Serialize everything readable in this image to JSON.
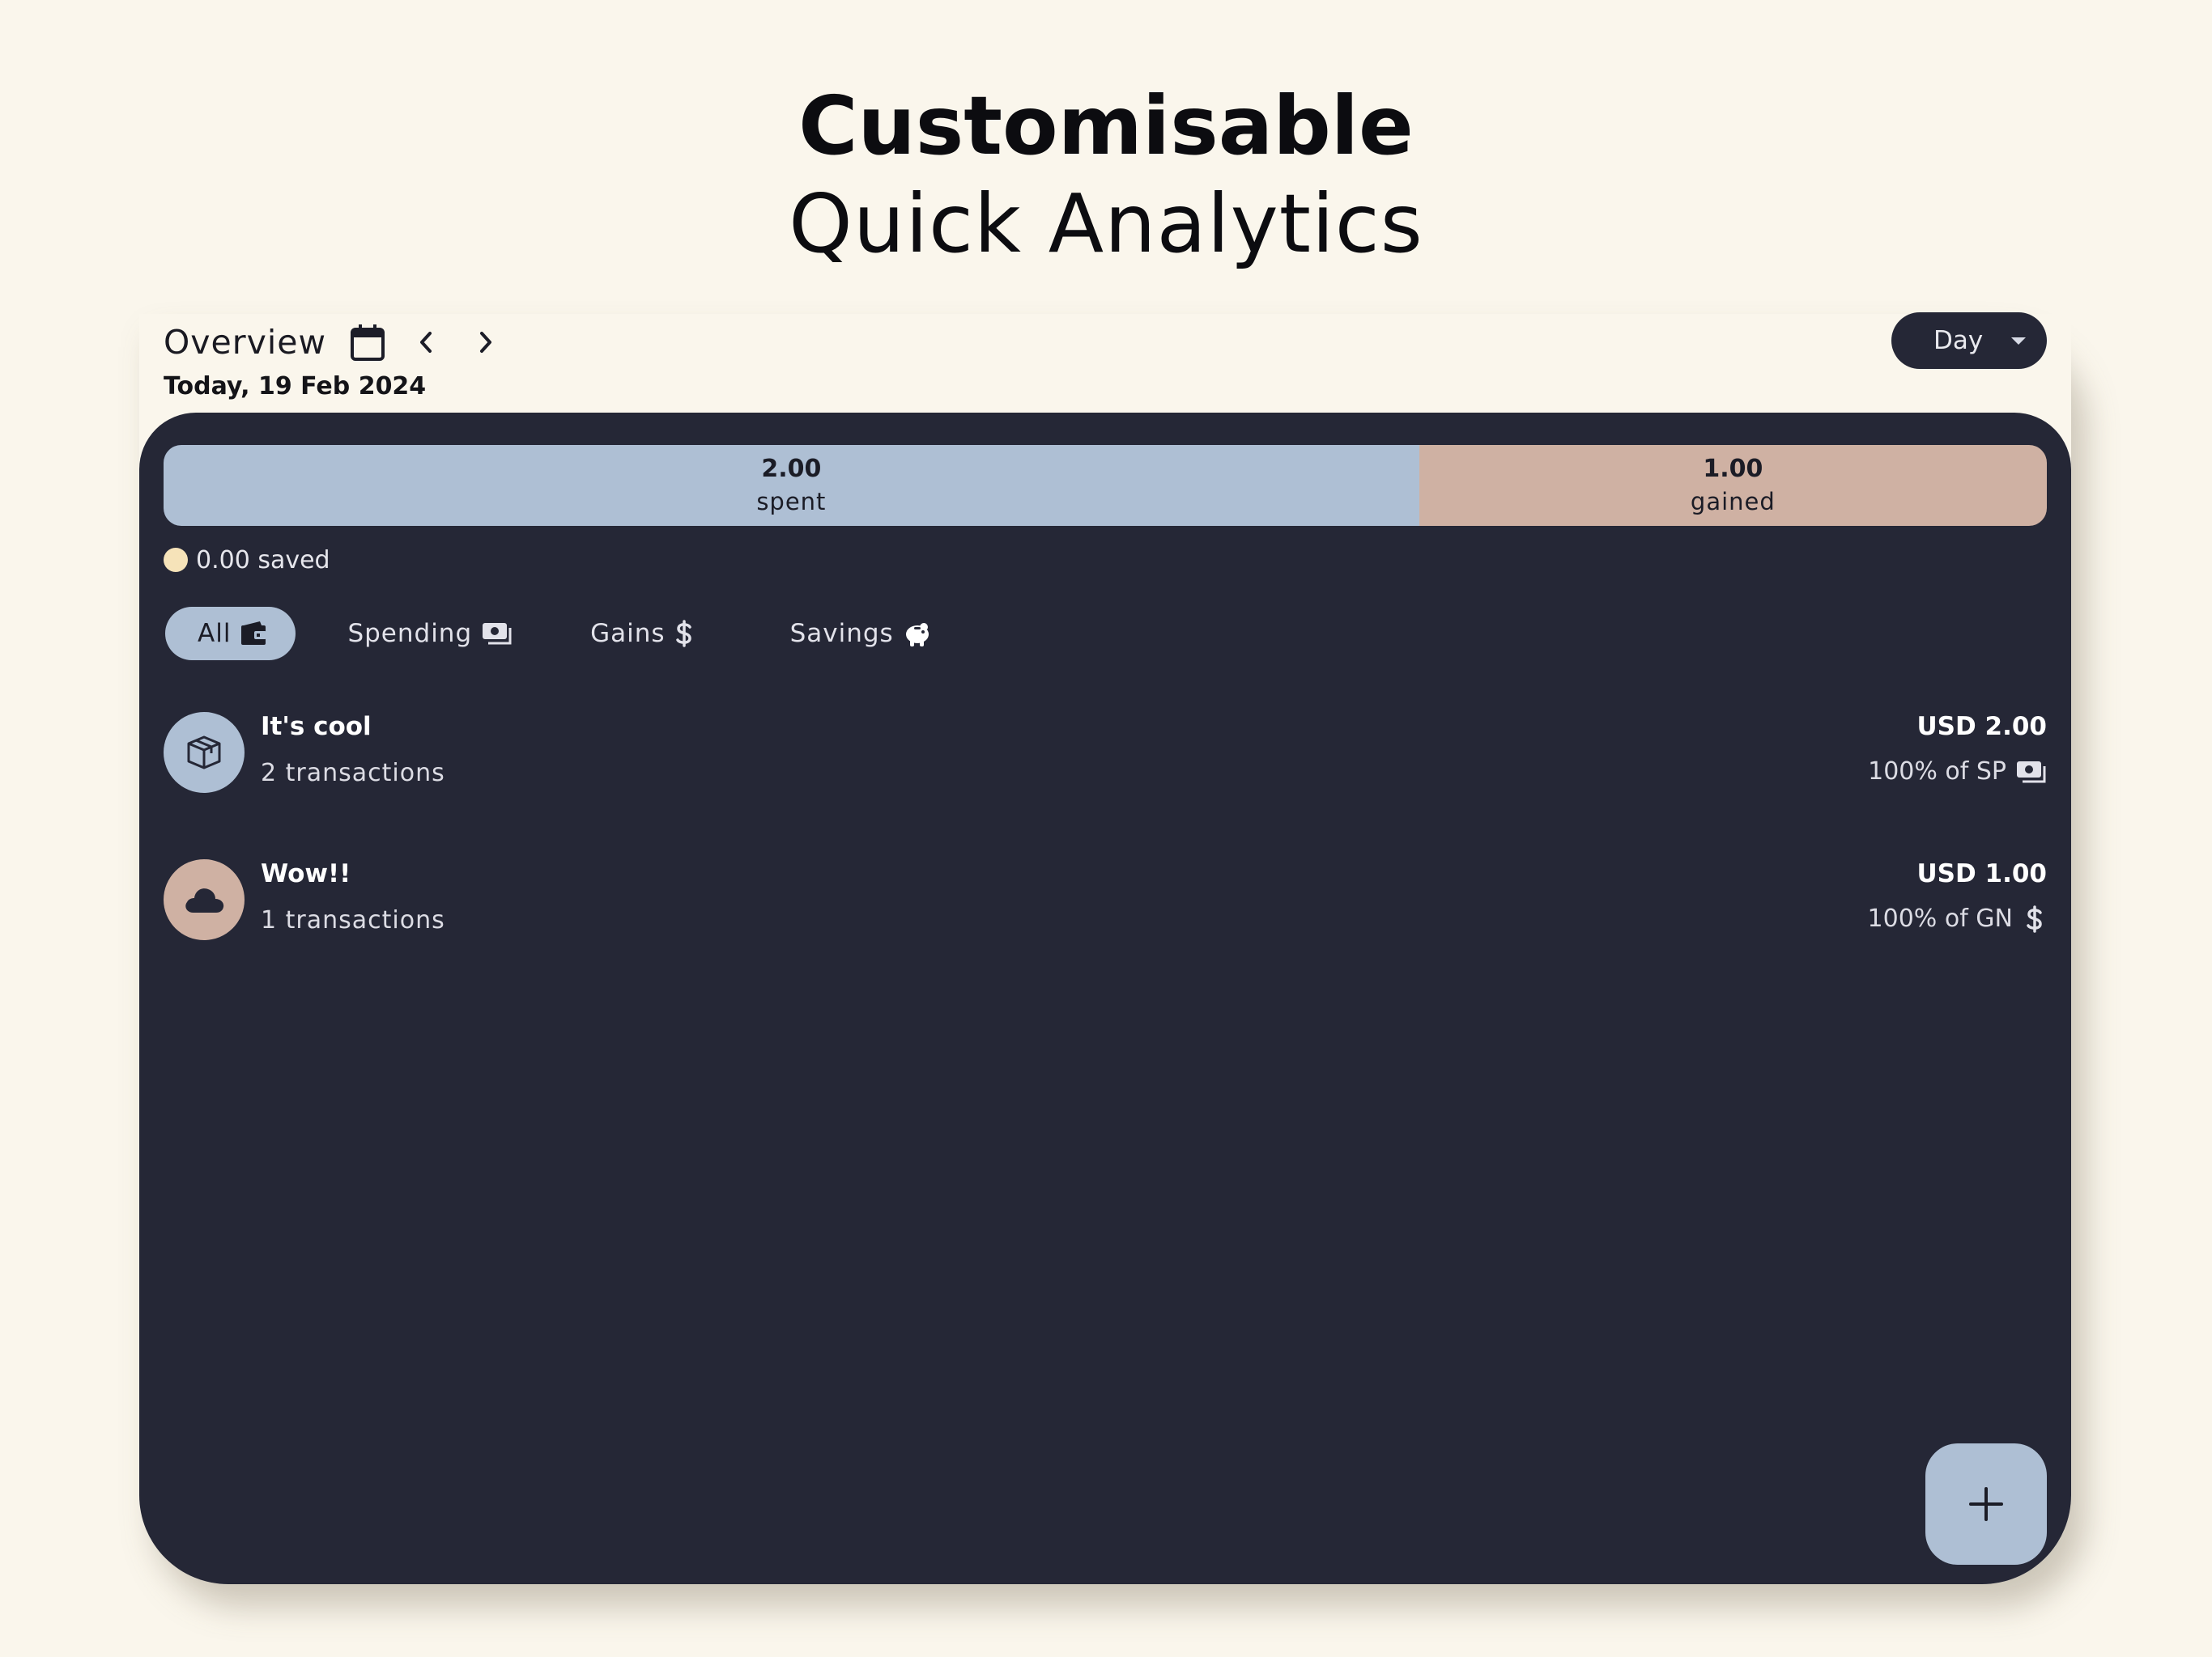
{
  "headline": {
    "title_bold": "Customisable",
    "title_light": "Quick Analytics"
  },
  "header": {
    "title": "Overview",
    "date": "Today, 19 Feb 2024",
    "period": "Day",
    "icons": [
      "calendar-icon",
      "chevron-left-icon",
      "chevron-right-icon",
      "caret-down-icon"
    ]
  },
  "summary": {
    "spent_value": "2.00",
    "spent_label": "spent",
    "gained_value": "1.00",
    "gained_label": "gained",
    "spent_fraction": 0.6667,
    "saved_text": "0.00 saved",
    "colors": {
      "spent": "#aebfd4",
      "gained": "#cfb1a3",
      "saved": "#f6e3b9"
    }
  },
  "tabs": [
    {
      "label": "All",
      "icon": "wallet-icon",
      "active": true
    },
    {
      "label": "Spending",
      "icon": "money-icon",
      "active": false
    },
    {
      "label": "Gains",
      "icon": "dollar-icon",
      "active": false
    },
    {
      "label": "Savings",
      "icon": "piggy-bank-icon",
      "active": false
    }
  ],
  "categories": [
    {
      "name": "It's cool",
      "transactions": "2 transactions",
      "amount": "USD 2.00",
      "share": "100% of SP",
      "icon": "box-icon",
      "share_icon": "money-icon"
    },
    {
      "name": "Wow!!",
      "transactions": "1 transactions",
      "amount": "USD 1.00",
      "share": "100% of GN",
      "icon": "cloud-icon",
      "share_icon": "dollar-icon"
    }
  ],
  "theme": {
    "background": "#faf6ec",
    "panel": "#252736",
    "accent": "#aebfd4"
  }
}
